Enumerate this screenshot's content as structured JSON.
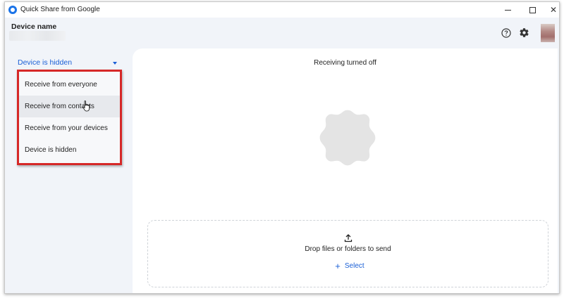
{
  "window": {
    "title": "Quick Share from Google"
  },
  "header": {
    "device_label": "Device name"
  },
  "sidebar": {
    "visibility_selected": "Device is hidden",
    "menu_items": [
      {
        "label": "Receive from everyone"
      },
      {
        "label": "Receive from contacts"
      },
      {
        "label": "Receive from your devices"
      },
      {
        "label": "Device is hidden"
      }
    ]
  },
  "main": {
    "status": "Receiving turned off",
    "drop_text": "Drop files or folders to send",
    "select_label": "Select"
  },
  "colors": {
    "accent": "#1a5fd6",
    "highlight": "#d62828",
    "badge": "#e4e4e4"
  },
  "icons": [
    "app-icon",
    "help-icon",
    "gear-icon",
    "chevron-down-icon",
    "cursor-icon",
    "upload-icon",
    "plus-icon"
  ]
}
